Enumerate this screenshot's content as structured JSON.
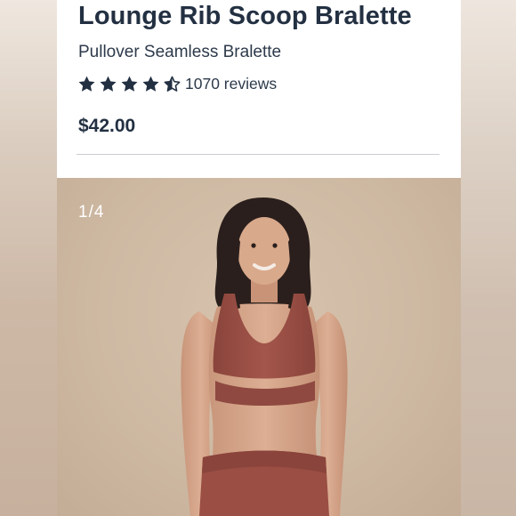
{
  "product": {
    "title": "Lounge Rib Scoop Bralette",
    "subtitle": "Pullover Seamless Bralette",
    "rating": 4.5,
    "reviews_label": "1070 reviews",
    "price": "$42.00"
  },
  "gallery": {
    "counter": "1/4"
  },
  "colors": {
    "text_dark": "#233042",
    "star": "#233042",
    "garment": "#9a4e44",
    "backdrop": "#d2bea9"
  },
  "icons": {
    "full_star": "star-icon",
    "half_star": "half-star-icon"
  }
}
